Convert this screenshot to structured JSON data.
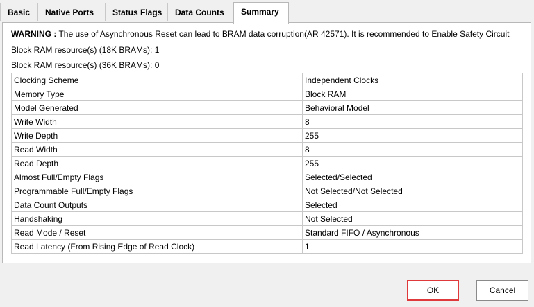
{
  "tabs": [
    {
      "label": "Basic"
    },
    {
      "label": "Native Ports"
    },
    {
      "label": "Status Flags"
    },
    {
      "label": "Data Counts"
    },
    {
      "label": "Summary"
    }
  ],
  "warning": {
    "prefix": "WARNING :",
    "text": " The use of Asynchronous Reset can lead to BRAM data corruption(AR 42571). It is recommended to Enable Safety Circuit"
  },
  "bram": {
    "line_18k": "Block RAM resource(s) (18K BRAMs): 1",
    "line_36k": "Block RAM resource(s) (36K BRAMs): 0"
  },
  "summary_rows": [
    {
      "key": "Clocking Scheme",
      "value": "Independent Clocks"
    },
    {
      "key": "Memory Type",
      "value": "Block RAM"
    },
    {
      "key": "Model Generated",
      "value": "Behavioral Model"
    },
    {
      "key": "Write Width",
      "value": "8"
    },
    {
      "key": "Write Depth",
      "value": "255"
    },
    {
      "key": "Read Width",
      "value": "8"
    },
    {
      "key": "Read Depth",
      "value": "255"
    },
    {
      "key": "Almost Full/Empty Flags",
      "value": "Selected/Selected"
    },
    {
      "key": "Programmable Full/Empty Flags",
      "value": "Not Selected/Not Selected"
    },
    {
      "key": "Data Count Outputs",
      "value": "Selected"
    },
    {
      "key": "Handshaking",
      "value": "Not Selected"
    },
    {
      "key": "Read Mode / Reset",
      "value": "Standard FIFO / Asynchronous"
    },
    {
      "key": "Read Latency (From Rising Edge of Read Clock)",
      "value": "1"
    }
  ],
  "buttons": {
    "ok": "OK",
    "cancel": "Cancel"
  },
  "colors": {
    "ok_highlight": "#e0393b"
  }
}
